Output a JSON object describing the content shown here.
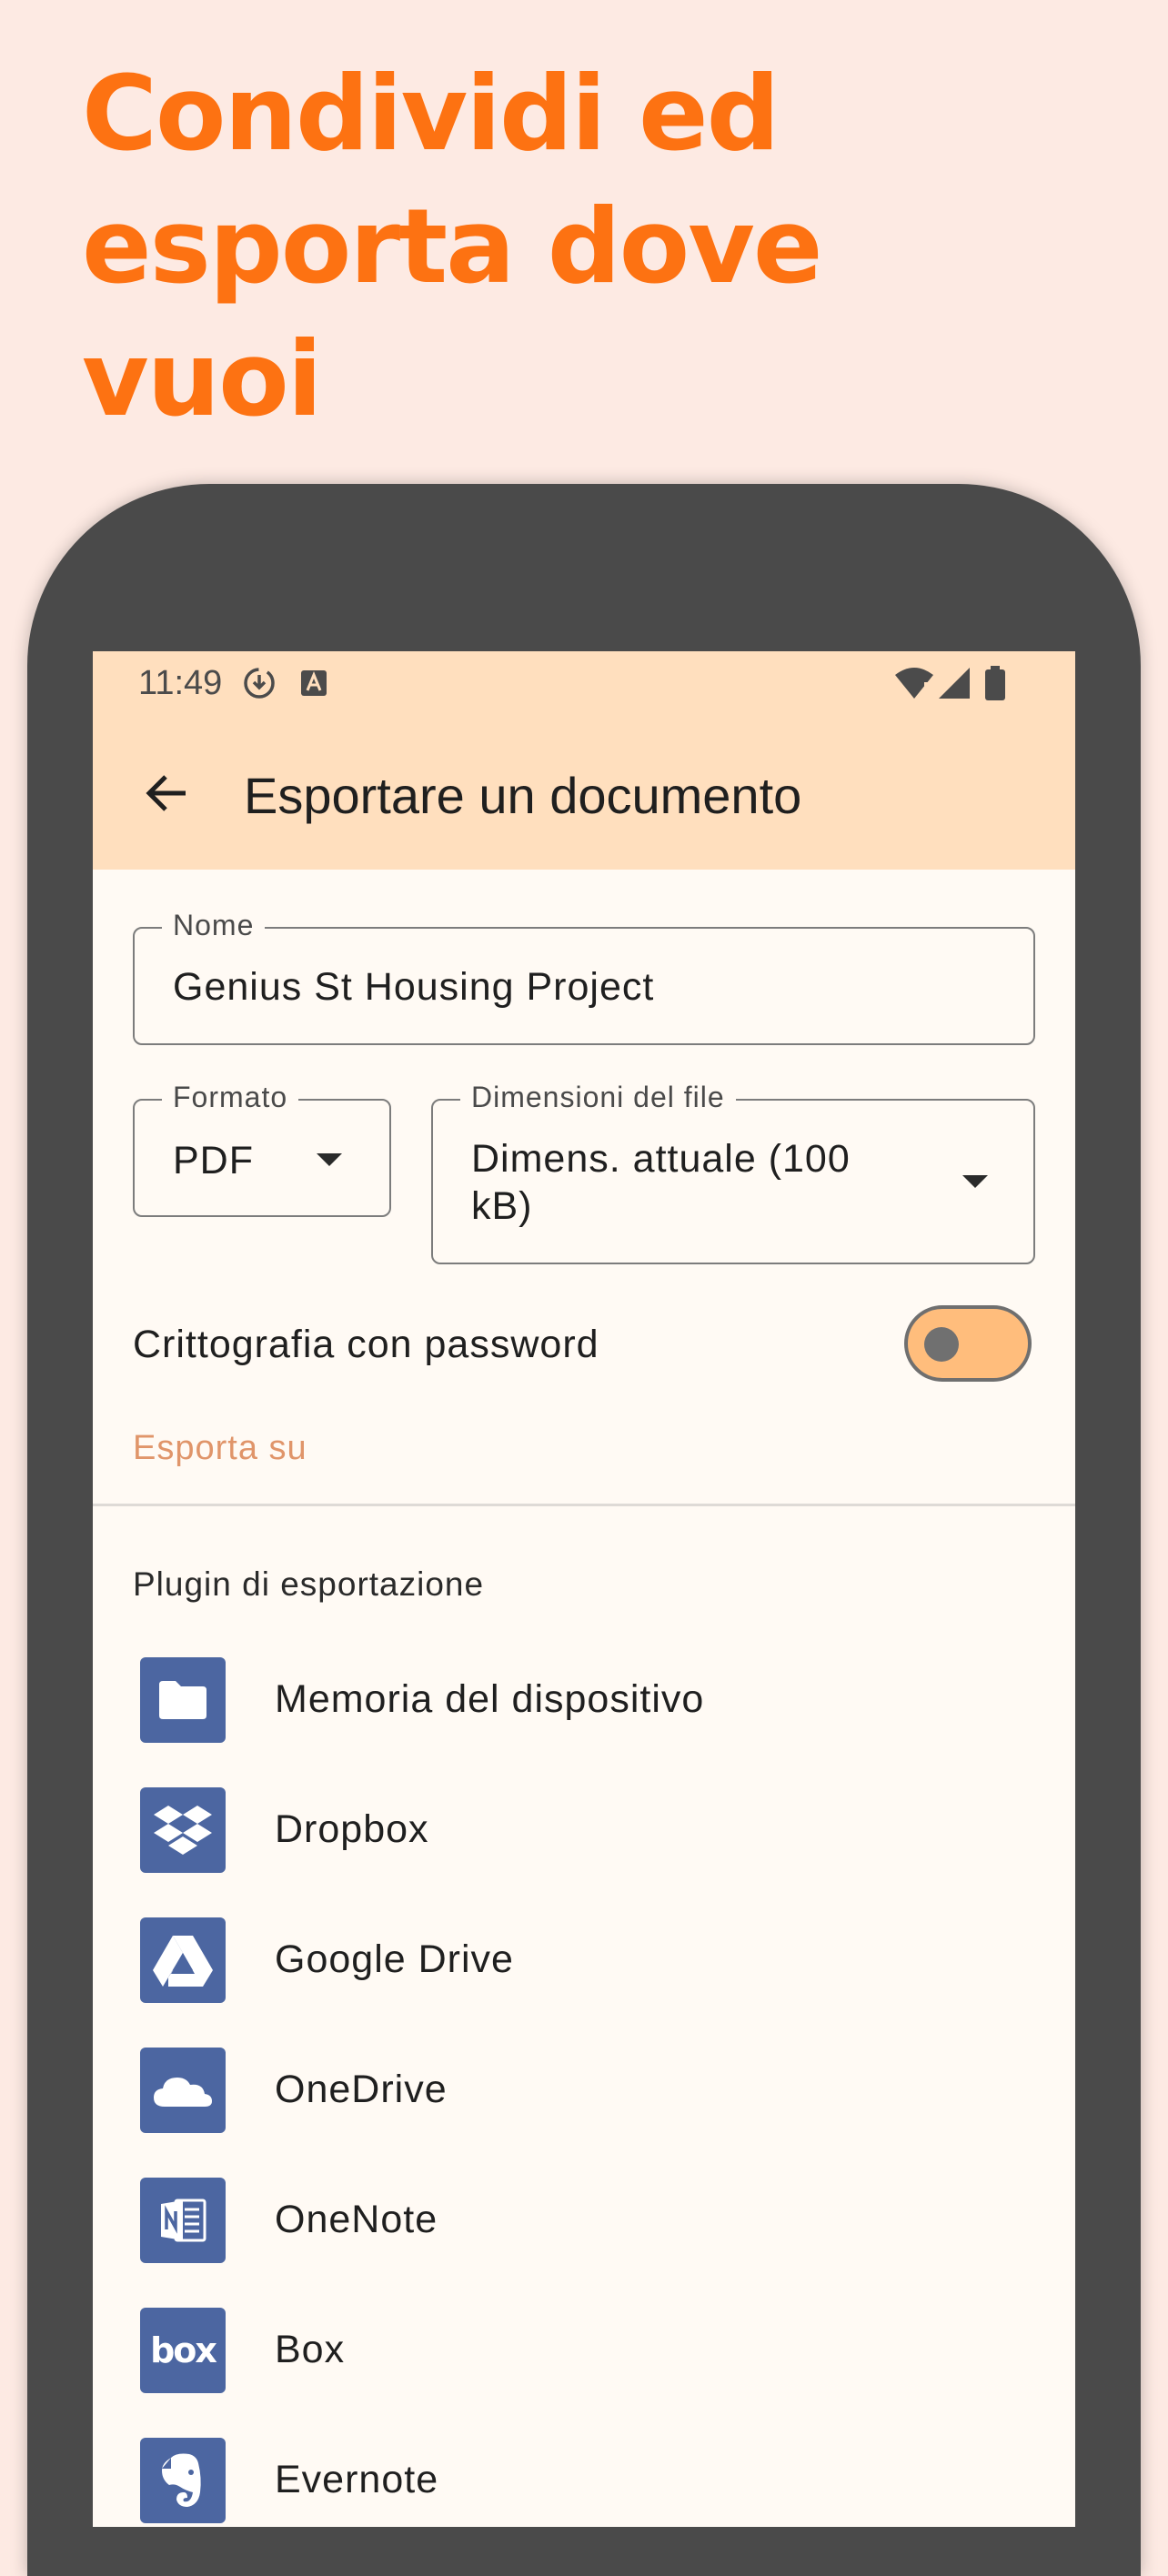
{
  "promo": {
    "headline_line1": "Condividi ed",
    "headline_line2": "esporta dove",
    "headline_line3": "vuoi",
    "accent_color": "#fd7212"
  },
  "status_bar": {
    "time": "11:49",
    "left_icons": [
      "download-circle-icon",
      "text-a-icon"
    ],
    "right_icons": [
      "wifi-alert-icon",
      "signal-icon",
      "battery-icon"
    ]
  },
  "app_bar": {
    "back_icon": "arrow-back-icon",
    "title": "Esportare un documento",
    "background": "#ffdfbe"
  },
  "form": {
    "name": {
      "label": "Nome",
      "value": "Genius St Housing Project"
    },
    "format": {
      "label": "Formato",
      "value": "PDF"
    },
    "file_size": {
      "label": "Dimensioni del file",
      "value_line1": "Dimens. attuale (100",
      "value_line2": "kB)"
    },
    "encryption": {
      "label": "Crittografia con password",
      "enabled": false
    }
  },
  "export": {
    "section_label": "Esporta su",
    "plugins_title": "Plugin di esportazione",
    "plugins": [
      {
        "label": "Memoria del dispositivo",
        "icon": "folder-icon"
      },
      {
        "label": "Dropbox",
        "icon": "dropbox-icon"
      },
      {
        "label": "Google Drive",
        "icon": "google-drive-icon"
      },
      {
        "label": "OneDrive",
        "icon": "onedrive-icon"
      },
      {
        "label": "OneNote",
        "icon": "onenote-icon"
      },
      {
        "label": "Box",
        "icon": "box-icon",
        "icon_text": "box"
      },
      {
        "label": "Evernote",
        "icon": "evernote-icon"
      }
    ],
    "tile_color": "#4c66a1"
  }
}
